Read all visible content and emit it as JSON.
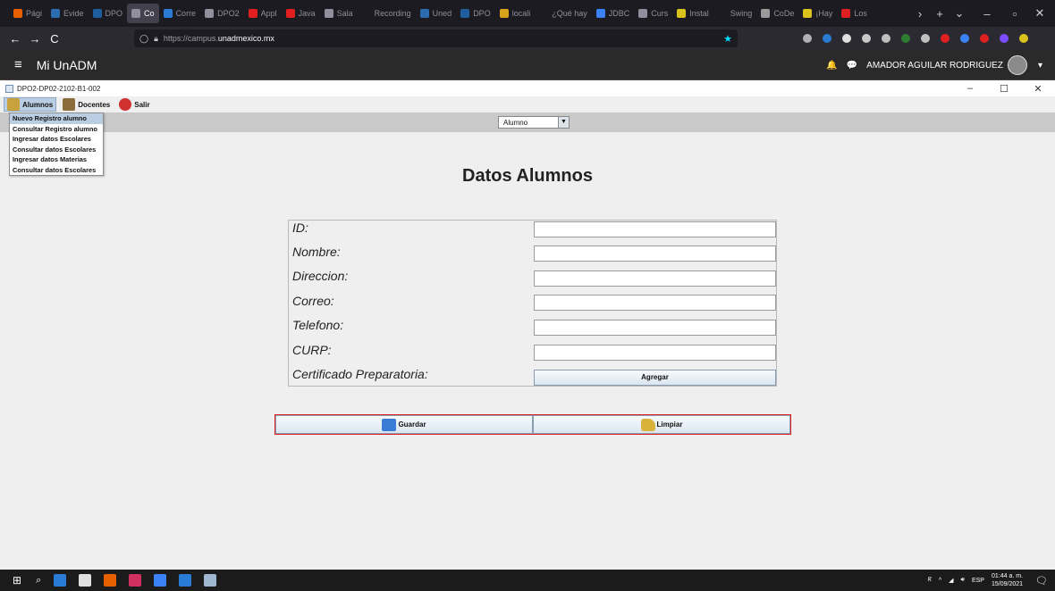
{
  "browser": {
    "tabs": [
      {
        "label": "Pági",
        "color": "#e66000"
      },
      {
        "label": "Evide",
        "color": "#2b6cb0"
      },
      {
        "label": "DPO",
        "color": "#1f5fa0"
      },
      {
        "label": "Co",
        "color": "#8f8f9d",
        "active": true
      },
      {
        "label": "Corre",
        "color": "#2a7bd4"
      },
      {
        "label": "DPO2",
        "color": "#8f8f9d"
      },
      {
        "label": "Appl",
        "color": "#e02020"
      },
      {
        "label": "Java",
        "color": "#e02020"
      },
      {
        "label": "Sala",
        "color": "#8f8f9d"
      },
      {
        "label": "Recording",
        "color": "#1c1b22"
      },
      {
        "label": "Uned",
        "color": "#2b6cb0"
      },
      {
        "label": "DPO",
        "color": "#1f5fa0"
      },
      {
        "label": "locali",
        "color": "#d9a21b"
      },
      {
        "label": "¿Qué hay",
        "color": "#1c1b22"
      },
      {
        "label": "JDBC",
        "color": "#3b82f6"
      },
      {
        "label": "Curs",
        "color": "#8f8f9d"
      },
      {
        "label": "Instal",
        "color": "#d9c21b"
      },
      {
        "label": "Swing",
        "color": "#1c1b22"
      },
      {
        "label": "CoDe",
        "color": "#9a9a9a"
      },
      {
        "label": "¡Hay",
        "color": "#d9c21b"
      },
      {
        "label": "Los",
        "color": "#e02020"
      }
    ],
    "nav": {
      "back": "←",
      "forward": "→",
      "reload": "C"
    },
    "url_prefix": "https://campus.",
    "url_domain": "unadmexico.mx",
    "tab_controls": {
      "scroll": "›",
      "new": "+",
      "list": "⌄",
      "min": "–",
      "restore": "▫",
      "close": "✕"
    },
    "ext_colors": [
      "#b0b0b8",
      "#2a7bd4",
      "#e0e0e0",
      "#c9c9c9",
      "#bfbfbf",
      "#2e7d32",
      "#c0c0c0",
      "#e02020",
      "#3b82f6",
      "#e02020",
      "#7c4dff",
      "#d9c21b"
    ]
  },
  "site": {
    "menu_icon": "≡",
    "brand": "Mi UnADM",
    "user_name": "AMADOR AGUILAR RODRIGUEZ",
    "bell_icon": "🔔",
    "chat_icon": "💬",
    "caret": "▾"
  },
  "window": {
    "title": "DPO2-DP02-2102-B1-002",
    "controls": {
      "min": "–",
      "max": "☐",
      "close": "✕"
    },
    "menus": [
      {
        "label": "Alumnos",
        "open": true,
        "color": "#c8a23c"
      },
      {
        "label": "Docentes",
        "color": "#8a6d3b"
      },
      {
        "label": "Salir",
        "color": "#d03030"
      }
    ],
    "dropdown_items": [
      "Nuevo Registro alumno",
      "Consultar Registro alumno",
      "Ingresar datos Escolares",
      "Consultar datos Escolares",
      "Ingresar datos Materias",
      "Consultar datos Escolares"
    ],
    "combo": {
      "value": "Alumno",
      "arrow": "▼"
    }
  },
  "form": {
    "title": "Datos Alumnos",
    "fields": [
      {
        "label": "ID:",
        "value": ""
      },
      {
        "label": "Nombre:",
        "value": ""
      },
      {
        "label": "Direccion:",
        "value": ""
      },
      {
        "label": "Correo:",
        "value": ""
      },
      {
        "label": "Telefono:",
        "value": ""
      },
      {
        "label": "CURP:",
        "value": ""
      }
    ],
    "cert_label": "Certificado Preparatoria:",
    "add_button": "Agregar",
    "save_button": "Guardar",
    "clear_button": "Limpiar"
  },
  "taskbar": {
    "app_colors": [
      "#2a7bd4",
      "#e0e0e0",
      "#e66000",
      "#d03060",
      "#3b82f6",
      "#2a7bd4",
      "#9fb7d0"
    ],
    "lang": "ESP",
    "time": "01:44 a. m.",
    "date": "15/09/2021"
  }
}
